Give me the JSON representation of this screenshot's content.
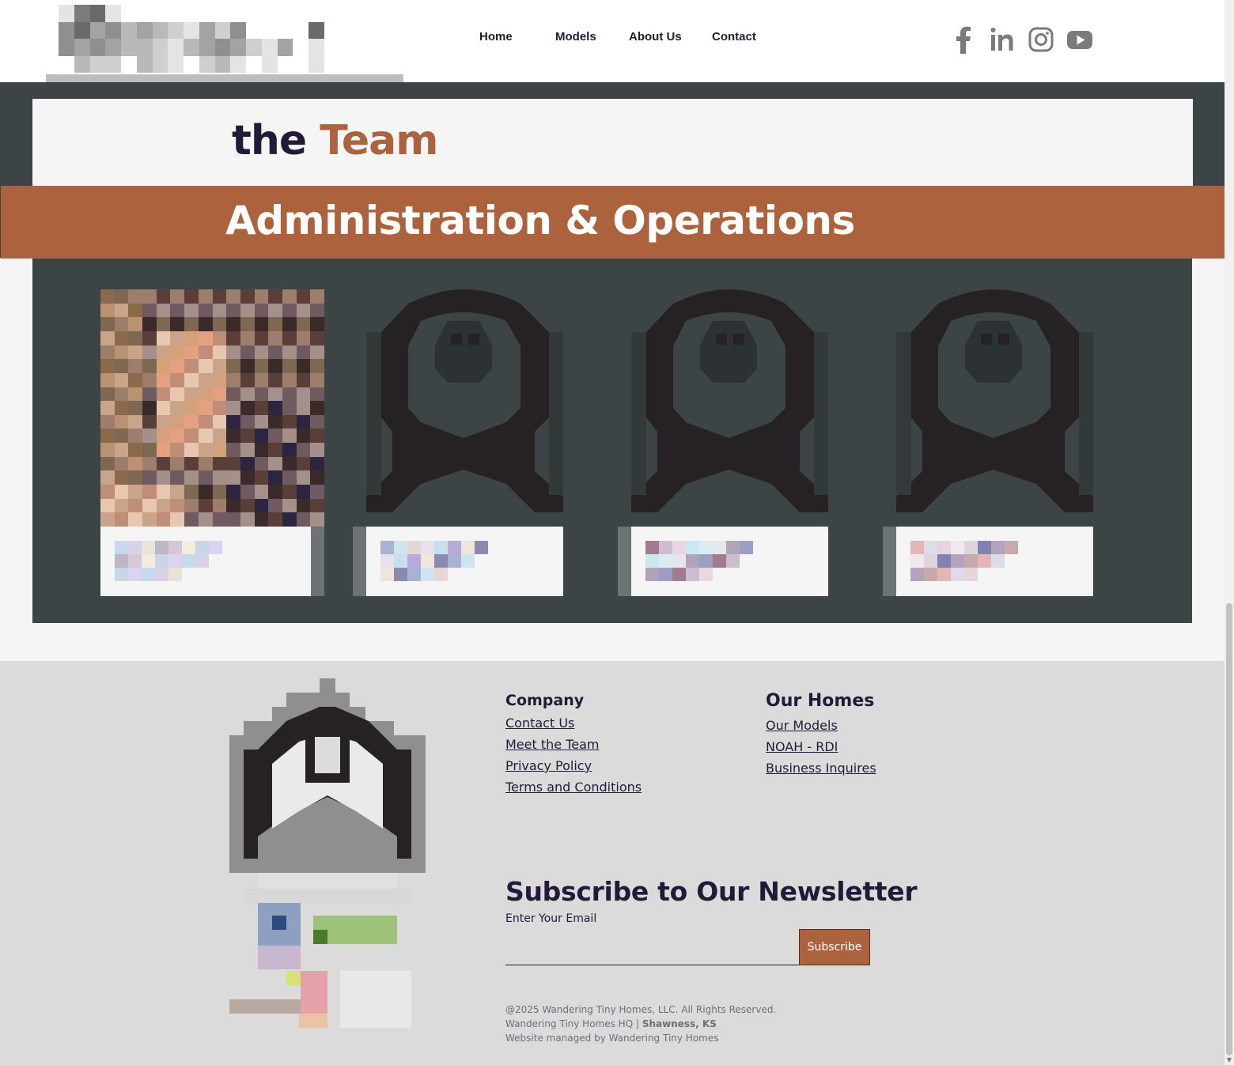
{
  "header": {
    "logo_alt": "Wandering Tiny Homes logo",
    "nav": [
      {
        "label": "Home"
      },
      {
        "label": "Models"
      },
      {
        "label": "About Us"
      },
      {
        "label": "Contact"
      }
    ],
    "social": [
      "facebook-icon",
      "linkedin-icon",
      "instagram-icon",
      "youtube-icon"
    ],
    "icon_color": "#7a7a7a"
  },
  "team": {
    "title_word1": "the",
    "title_word2": "Team",
    "section_heading": "Administration & Operations",
    "members": [
      {
        "photo": "person-photo"
      },
      {
        "photo": "placeholder-avatar"
      },
      {
        "photo": "placeholder-avatar"
      },
      {
        "photo": "placeholder-avatar"
      }
    ]
  },
  "footer": {
    "company_title": "Company",
    "company_links": [
      "Contact Us",
      "Meet the Team",
      "Privacy Policy",
      "Terms and Conditions"
    ],
    "homes_title": "Our Homes",
    "homes_links": [
      "Our Models",
      "NOAH - RDI",
      "Business Inquires"
    ],
    "newsletter_title": "Subscribe to Our Newsletter",
    "email_label": "Enter Your Email",
    "email_value": "",
    "subscribe_label": "Subscribe",
    "copyright": "@2025 Wandering Tiny Homes, LLC. All Rights Reserved.",
    "hq_prefix": "Wandering Tiny Homes HQ",
    "hq_separator": " | ",
    "hq_location": "Shawness, KS",
    "managed_by": "Website managed by Wandering Tiny Homes"
  },
  "colors": {
    "accent": "#ad623e",
    "navy": "#221a38",
    "slate": "#3d4446",
    "footer_bg": "#dbdbdb"
  }
}
